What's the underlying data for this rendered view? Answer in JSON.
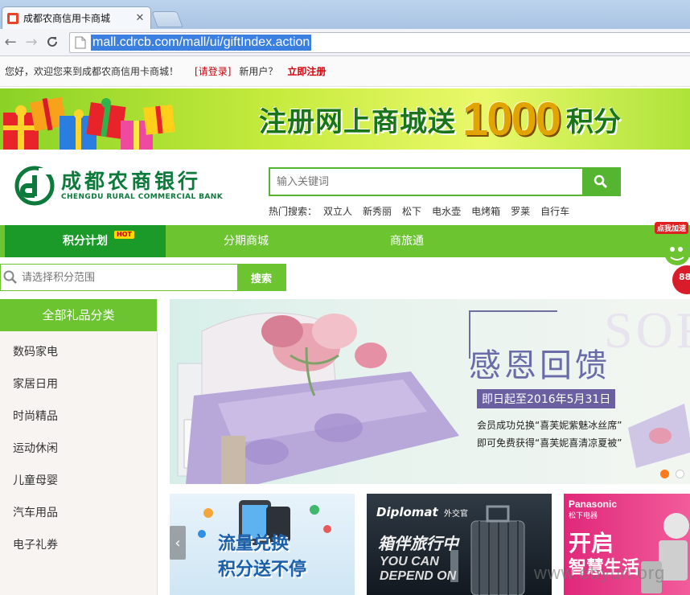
{
  "browser": {
    "tab_title": "成都农商信用卡商城",
    "url": "mall.cdrcb.com/mall/ui/giftIndex.action"
  },
  "topbar": {
    "welcome": "您好，欢迎您来到成都农商信用卡商城！",
    "login": "[请登录]",
    "new_user": "新用户？",
    "register": "立即注册"
  },
  "promo": {
    "text_before": "注册网上商城送",
    "number": "1000",
    "text_after": "积分"
  },
  "logo": {
    "name_cn": "成都农商银行",
    "name_en": "CHENGDU RURAL COMMERCIAL BANK"
  },
  "search": {
    "placeholder": "输入关键词",
    "hot_label": "热门搜索：",
    "hot_keywords": [
      "双立人",
      "新秀丽",
      "松下",
      "电水壶",
      "电烤箱",
      "罗莱",
      "自行车"
    ]
  },
  "nav": {
    "items": [
      "积分计划",
      "分期商城",
      "商旅通"
    ],
    "hot_badge": "HOT"
  },
  "float_widget": {
    "tag": "点我加速",
    "number": "88"
  },
  "range_search": {
    "placeholder": "请选择积分范围",
    "button": "搜索"
  },
  "sidebar": {
    "title": "全部礼品分类",
    "items": [
      "数码家电",
      "家居日用",
      "时尚精品",
      "运动休闲",
      "儿童母婴",
      "汽车用品",
      "电子礼券"
    ]
  },
  "carousel": {
    "bg_word": "SOFTIN",
    "headline": "感恩回馈",
    "date": "即日起至2016年5月31日",
    "line1": "会员成功兑换“喜芙妮紫魅冰丝席”",
    "line2": "即可免费获得“喜芙妮喜清凉夏被”",
    "active_slide": 1,
    "slide_count": 2
  },
  "tiles": {
    "t1_line1": "流量兑换",
    "t1_line2": "积分送不停",
    "t2_brand": "Diplomat",
    "t2_brand_cn": "外交官",
    "t2_tag": "箱伴旅行中",
    "t2_en1": "YOU CAN",
    "t2_en2": "DEPEND ON",
    "t3_brand": "Panasonic",
    "t3_brand_cn": "松下电器",
    "t3_line1": "开启",
    "t3_line2": "智慧生活"
  },
  "watermark": "www.ebyun.org",
  "colors": {
    "brand_green": "#6cc431",
    "active_green": "#1b9a29",
    "logo_green": "#0b7a3b",
    "register_red": "#d0000b"
  }
}
